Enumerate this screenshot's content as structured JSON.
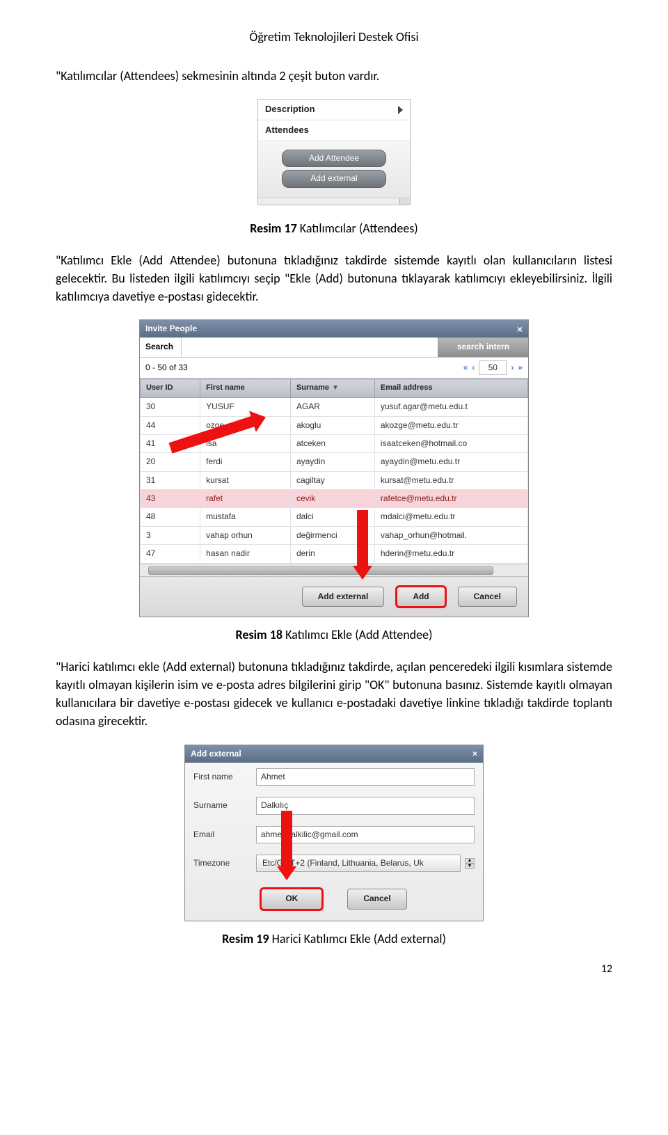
{
  "header": "Öğretim Teknolojileri Destek Ofisi",
  "p1": "\"Katılımcılar (Attendees) sekmesinin altında 2 çeşit buton vardır.",
  "fig1": {
    "row_desc": "Description",
    "row_att": "Attendees",
    "btn_add_attendee": "Add Attendee",
    "btn_add_external": "Add external"
  },
  "caption17_b": "Resim 17",
  "caption17_rest": " Katılımcılar (Attendees)",
  "p2": "\"Katılımcı Ekle (Add Attendee) butonuna tıkladığınız takdirde sistemde kayıtlı olan kullanıcıların listesi gelecektir. Bu listeden ilgili katılımcıyı seçip \"Ekle (Add) butonuna tıklayarak katılımcıyı ekleyebilirsiniz. İlgili katılımcıya davetiye e-postası gidecektir.",
  "fig2": {
    "title": "Invite People",
    "search_label": "Search",
    "search_btn": "search intern",
    "pager": {
      "range": "0 - 50 of 33",
      "page_size": "50",
      "first": "«",
      "prev": "‹",
      "next": "›",
      "last": "»"
    },
    "cols": {
      "user_id": "User ID",
      "first_name": "First name",
      "surname": "Surname",
      "email": "Email address"
    },
    "rows": [
      {
        "id": "30",
        "fn": "YUSUF",
        "sn": "AGAR",
        "em": "yusuf.agar@metu.edu.t"
      },
      {
        "id": "44",
        "fn": "ozge",
        "sn": "akoglu",
        "em": "akozge@metu.edu.tr"
      },
      {
        "id": "41",
        "fn": "isa",
        "sn": "atceken",
        "em": "isaatceken@hotmail.co"
      },
      {
        "id": "20",
        "fn": "ferdi",
        "sn": "ayaydin",
        "em": "ayaydin@metu.edu.tr"
      },
      {
        "id": "31",
        "fn": "kursat",
        "sn": "cagiltay",
        "em": "kursat@metu.edu.tr"
      },
      {
        "id": "43",
        "fn": "rafet",
        "sn": "cevik",
        "em": "rafetce@metu.edu.tr"
      },
      {
        "id": "48",
        "fn": "mustafa",
        "sn": "dalci",
        "em": "mdalci@metu.edu.tr"
      },
      {
        "id": "3",
        "fn": "vahap orhun",
        "sn": "değirmenci",
        "em": "vahap_orhun@hotmail."
      },
      {
        "id": "47",
        "fn": "hasan nadir",
        "sn": "derin",
        "em": "hderin@metu.edu.tr"
      }
    ],
    "actions": {
      "add_external": "Add external",
      "add": "Add",
      "cancel": "Cancel"
    }
  },
  "caption18_b": "Resim 18",
  "caption18_rest": " Katılımcı Ekle (Add Attendee)",
  "p3": "\"Harici katılımcı ekle (Add external) butonuna tıkladığınız takdirde, açılan penceredeki ilgili kısımlara sistemde kayıtlı olmayan kişilerin isim ve e-posta adres bilgilerini girip \"OK\" butonuna basınız. Sistemde kayıtlı olmayan kullanıcılara bir davetiye e-postası gidecek ve kullanıcı e-postadaki davetiye linkine tıkladığı takdirde toplantı odasına girecektir.",
  "fig3": {
    "title": "Add external",
    "labels": {
      "first_name": "First name",
      "surname": "Surname",
      "email": "Email",
      "timezone": "Timezone"
    },
    "values": {
      "first_name": "Ahmet",
      "surname": "Dalkılıç",
      "email": "ahmet.dalkilic@gmail.com",
      "timezone": "Etc/GMT+2 (Finland, Lithuania, Belarus, Uk"
    },
    "actions": {
      "ok": "OK",
      "cancel": "Cancel"
    }
  },
  "caption19_b": "Resim 19",
  "caption19_rest": " Harici Katılımcı Ekle (Add external)",
  "page_number": "12"
}
